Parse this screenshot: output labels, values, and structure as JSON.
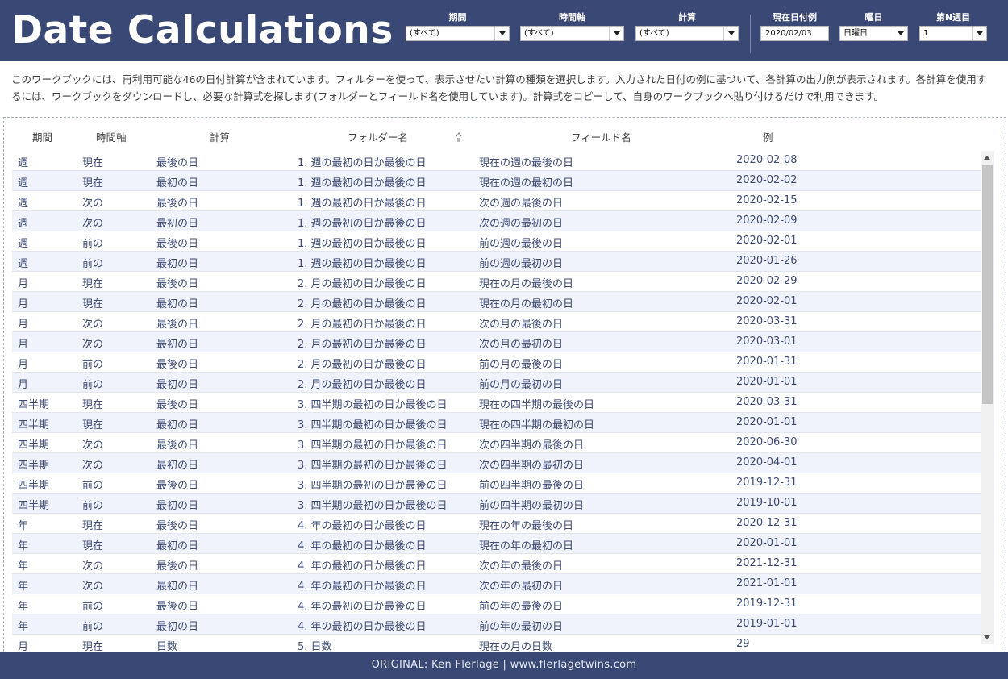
{
  "header": {
    "title": "Date Calculations",
    "filters": {
      "period": {
        "label": "期間",
        "value": "(すべて)"
      },
      "time_axis": {
        "label": "時間軸",
        "value": "(すべて)"
      },
      "calculation": {
        "label": "計算",
        "value": "(すべて)"
      },
      "current_date": {
        "label": "現在日付例",
        "value": "2020/02/03"
      },
      "weekday": {
        "label": "曜日",
        "value": "日曜日"
      },
      "nth_week": {
        "label": "第N週目",
        "value": "1"
      }
    }
  },
  "description": "このワークブックには、再利用可能な46の日付計算が含まれています。フィルターを使って、表示させたい計算の種類を選択します。入力された日付の例に基づいて、各計算の出力例が表示されます。各計算を使用するには、ワークブックをダウンロードし、必要な計算式を探します(フォルダーとフィールド名を使用しています)。計算式をコピーして、自身のワークブックへ貼り付けるだけで利用できます。",
  "table": {
    "columns": [
      "期間",
      "時間軸",
      "計算",
      "フォルダー名",
      "フィールド名",
      "例"
    ],
    "rows": [
      [
        "週",
        "現在",
        "最後の日",
        "1. 週の最初の日か最後の日",
        "現在の週の最後の日",
        "2020-02-08"
      ],
      [
        "週",
        "現在",
        "最初の日",
        "1. 週の最初の日か最後の日",
        "現在の週の最初の日",
        "2020-02-02"
      ],
      [
        "週",
        "次の",
        "最後の日",
        "1. 週の最初の日か最後の日",
        "次の週の最後の日",
        "2020-02-15"
      ],
      [
        "週",
        "次の",
        "最初の日",
        "1. 週の最初の日か最後の日",
        "次の週の最初の日",
        "2020-02-09"
      ],
      [
        "週",
        "前の",
        "最後の日",
        "1. 週の最初の日か最後の日",
        "前の週の最後の日",
        "2020-02-01"
      ],
      [
        "週",
        "前の",
        "最初の日",
        "1. 週の最初の日か最後の日",
        "前の週の最初の日",
        "2020-01-26"
      ],
      [
        "月",
        "現在",
        "最後の日",
        "2. 月の最初の日か最後の日",
        "現在の月の最後の日",
        "2020-02-29"
      ],
      [
        "月",
        "現在",
        "最初の日",
        "2. 月の最初の日か最後の日",
        "現在の月の最初の日",
        "2020-02-01"
      ],
      [
        "月",
        "次の",
        "最後の日",
        "2. 月の最初の日か最後の日",
        "次の月の最後の日",
        "2020-03-31"
      ],
      [
        "月",
        "次の",
        "最初の日",
        "2. 月の最初の日か最後の日",
        "次の月の最初の日",
        "2020-03-01"
      ],
      [
        "月",
        "前の",
        "最後の日",
        "2. 月の最初の日か最後の日",
        "前の月の最後の日",
        "2020-01-31"
      ],
      [
        "月",
        "前の",
        "最初の日",
        "2. 月の最初の日か最後の日",
        "前の月の最初の日",
        "2020-01-01"
      ],
      [
        "四半期",
        "現在",
        "最後の日",
        "3. 四半期の最初の日か最後の日",
        "現在の四半期の最後の日",
        "2020-03-31"
      ],
      [
        "四半期",
        "現在",
        "最初の日",
        "3. 四半期の最初の日か最後の日",
        "現在の四半期の最初の日",
        "2020-01-01"
      ],
      [
        "四半期",
        "次の",
        "最後の日",
        "3. 四半期の最初の日か最後の日",
        "次の四半期の最後の日",
        "2020-06-30"
      ],
      [
        "四半期",
        "次の",
        "最初の日",
        "3. 四半期の最初の日か最後の日",
        "次の四半期の最初の日",
        "2020-04-01"
      ],
      [
        "四半期",
        "前の",
        "最後の日",
        "3. 四半期の最初の日か最後の日",
        "前の四半期の最後の日",
        "2019-12-31"
      ],
      [
        "四半期",
        "前の",
        "最初の日",
        "3. 四半期の最初の日か最後の日",
        "前の四半期の最初の日",
        "2019-10-01"
      ],
      [
        "年",
        "現在",
        "最後の日",
        "4. 年の最初の日か最後の日",
        "現在の年の最後の日",
        "2020-12-31"
      ],
      [
        "年",
        "現在",
        "最初の日",
        "4. 年の最初の日か最後の日",
        "現在の年の最初の日",
        "2020-01-01"
      ],
      [
        "年",
        "次の",
        "最後の日",
        "4. 年の最初の日か最後の日",
        "次の年の最後の日",
        "2021-12-31"
      ],
      [
        "年",
        "次の",
        "最初の日",
        "4. 年の最初の日か最後の日",
        "次の年の最初の日",
        "2021-01-01"
      ],
      [
        "年",
        "前の",
        "最後の日",
        "4. 年の最初の日か最後の日",
        "前の年の最後の日",
        "2019-12-31"
      ],
      [
        "年",
        "前の",
        "最初の日",
        "4. 年の最初の日か最後の日",
        "前の年の最初の日",
        "2019-01-01"
      ],
      [
        "月",
        "現在",
        "日数",
        "5. 日数",
        "現在の月の日数",
        "29"
      ]
    ]
  },
  "footer": {
    "text": "ORIGINAL: Ken Flerlage | www.flerlagetwins.com"
  },
  "colors": {
    "header_bg": "#394874",
    "row_alt": "#f0f3fb",
    "row_text": "#3c4a74"
  }
}
